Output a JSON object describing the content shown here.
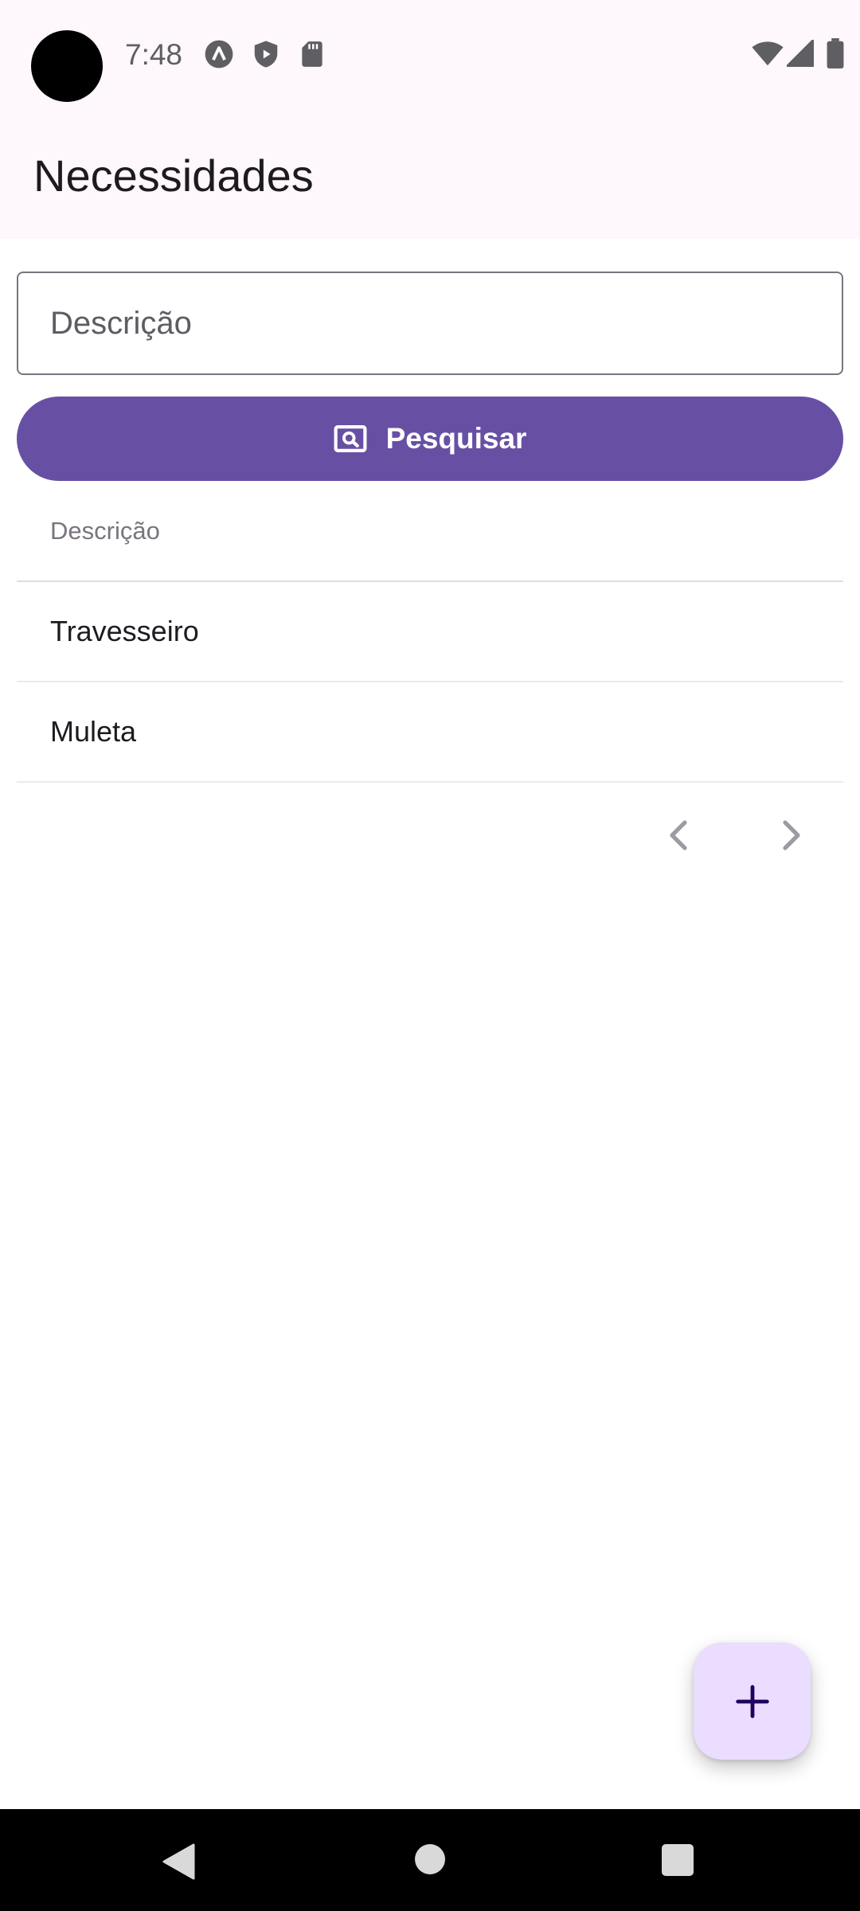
{
  "status_bar": {
    "time": "7:48",
    "left_icons": [
      "app-a-icon",
      "shield-play-icon",
      "sd-card-icon"
    ],
    "right_icons": [
      "wifi-icon",
      "cellular-signal-icon",
      "battery-icon"
    ]
  },
  "app_bar": {
    "title": "Necessidades"
  },
  "search": {
    "placeholder": "Descrição",
    "value": ""
  },
  "search_button": {
    "label": "Pesquisar",
    "icon": "image-search-icon"
  },
  "table": {
    "column_header": "Descrição",
    "rows": [
      "Travesseiro",
      "Muleta"
    ]
  },
  "pagination": {
    "prev_icon": "chevron-left-icon",
    "next_icon": "chevron-right-icon"
  },
  "fab": {
    "icon": "plus-icon"
  },
  "nav_bar": {
    "icons": [
      "back-icon",
      "home-icon",
      "recents-icon"
    ]
  },
  "colors": {
    "primary": "#6750a4",
    "surface_tint": "#fef7fc",
    "fab_container": "#eaddff",
    "fab_icon": "#21005d"
  }
}
